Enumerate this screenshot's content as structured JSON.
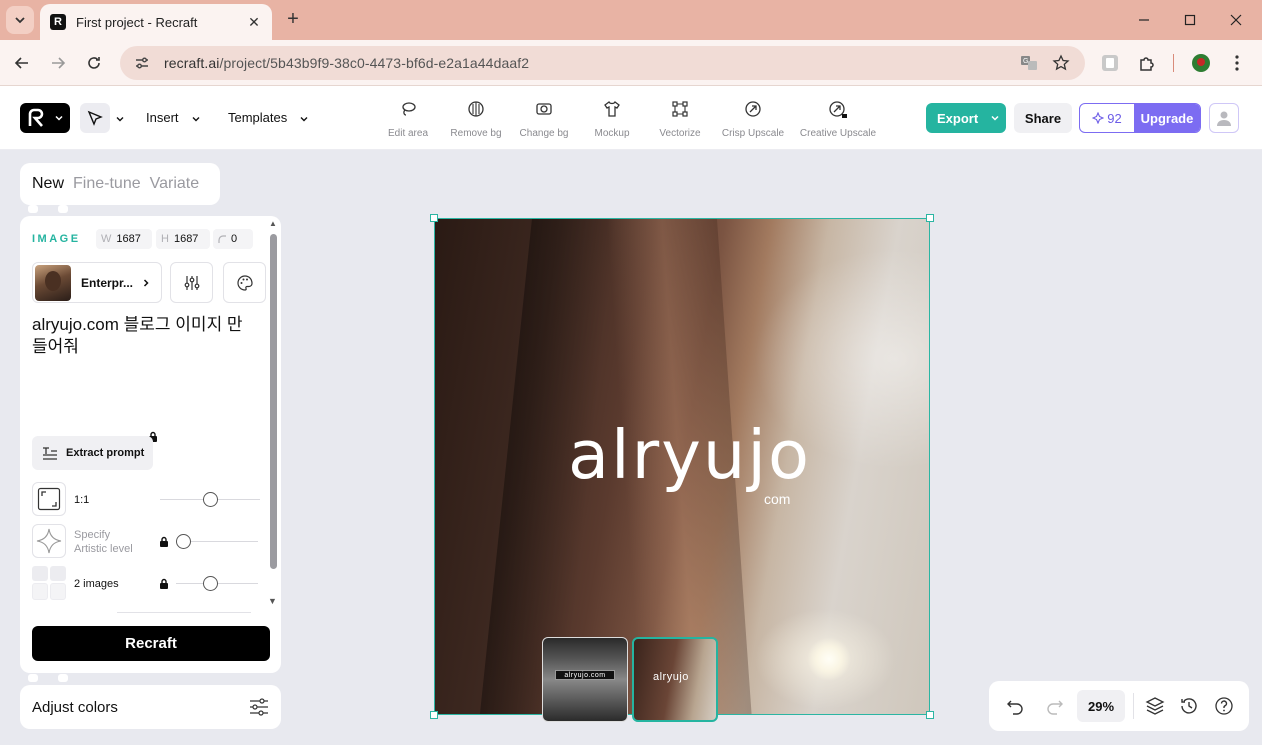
{
  "browser": {
    "tab_title": "First project - Recraft",
    "url_host": "recraft.ai",
    "url_path": "/project/5b43b9f9-38c0-4473-bf6d-e2a1a44daaf2"
  },
  "header": {
    "insert_label": "Insert",
    "templates_label": "Templates",
    "tools": [
      {
        "label": "Edit area",
        "icon": "lasso-icon"
      },
      {
        "label": "Remove bg",
        "icon": "remove-bg-icon"
      },
      {
        "label": "Change bg",
        "icon": "change-bg-icon"
      },
      {
        "label": "Mockup",
        "icon": "tshirt-icon"
      },
      {
        "label": "Vectorize",
        "icon": "vectorize-icon"
      },
      {
        "label": "Crisp Upscale",
        "icon": "upscale-icon"
      },
      {
        "label": "Creative Upscale",
        "icon": "creative-upscale-icon"
      }
    ],
    "export_label": "Export",
    "share_label": "Share",
    "credits": "92",
    "upgrade_label": "Upgrade",
    "accent_color": "#25b4a0",
    "upgrade_color": "#7c6cf2"
  },
  "left_panel": {
    "mode_tabs": [
      "New",
      "Fine-tune",
      "Variate"
    ],
    "active_mode": "New",
    "section_label": "IMAGE",
    "width_key": "W",
    "width_value": "1687",
    "height_key": "H",
    "height_value": "1687",
    "corner_value": "0",
    "style_name": "Enterpr...",
    "prompt_text": "alryujo.com 블로그 이미지 만들어줘",
    "extract_label": "Extract prompt",
    "aspect_label": "1:1",
    "aspect_level": 0.5,
    "artistic_label_1": "Specify",
    "artistic_label_2": "Artistic level",
    "artistic_level": 0.0,
    "images_label": "2 images",
    "images_level": 0.4,
    "recraft_label": "Recraft",
    "adjust_label": "Adjust colors"
  },
  "canvas": {
    "brand_text": "alryujo",
    "brand_suffix": "com",
    "thumb_1_text": "alryujo.com",
    "thumb_2_text": "alryujo",
    "selected_thumb": 2
  },
  "controls": {
    "zoom": "29%"
  }
}
